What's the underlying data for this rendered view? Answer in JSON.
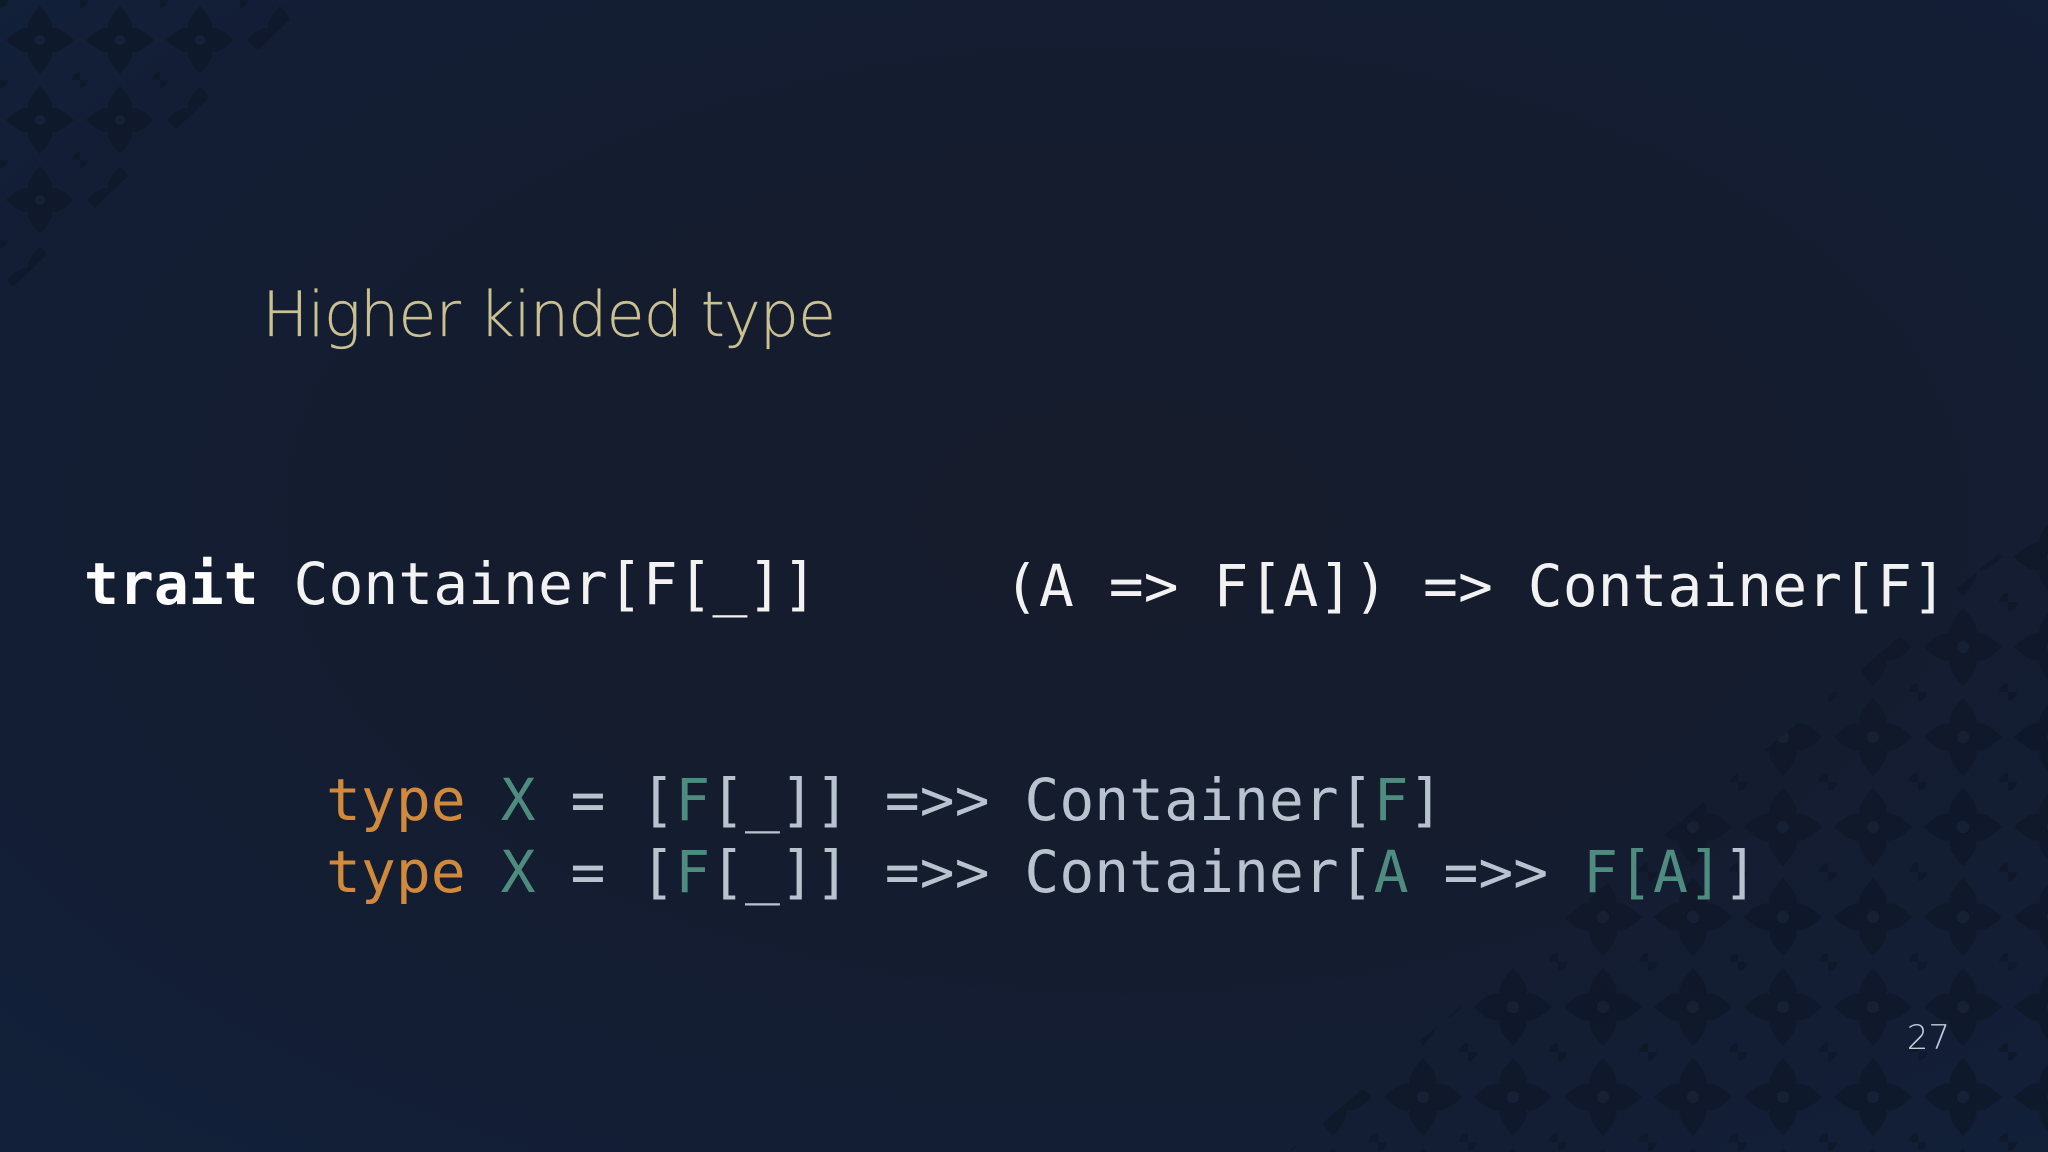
{
  "slide": {
    "title": "Higher kinded type",
    "page_number": "27",
    "ornament": "damask-ornament"
  },
  "code": {
    "line1": {
      "keyword": "trait",
      "rest": " Container[F[_]]"
    },
    "line1b": "(A => F[A]) => Container[F]",
    "line2": {
      "kw": "type",
      "sp1": " ",
      "var": "X",
      "eq": " = [",
      "f": "F",
      "bracket": "[_]] =>> Container[",
      "arg": "F",
      "close": "]"
    },
    "line3": {
      "kw": "type",
      "sp1": " ",
      "var": "X",
      "eq": " = [",
      "f": "F",
      "bracket": "[_]] =>> Container[",
      "a1": "A",
      "arrow": " =>> ",
      "f2": "F[A]",
      "close": "]"
    }
  },
  "colors": {
    "background": "#141c2e",
    "title": "#d9cf9a",
    "keyword_type": "#d18a3c",
    "type_var": "#4f8c80",
    "plain_code": "#b8c3cf",
    "white_code": "#f2f2f2"
  }
}
